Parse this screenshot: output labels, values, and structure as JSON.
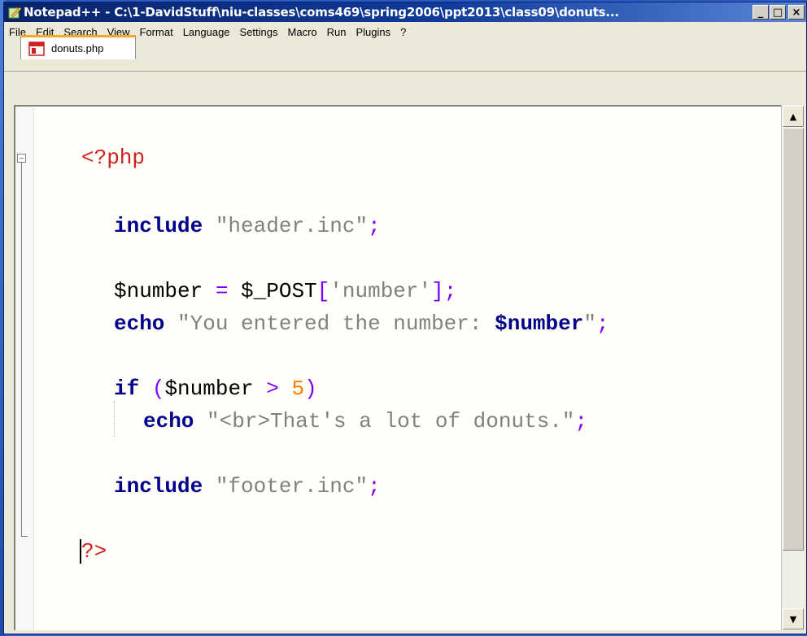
{
  "window": {
    "title": "Notepad++ - C:\\1-DavidStuff\\niu-classes\\coms469\\spring2006\\ppt2013\\class09\\donuts...",
    "minimize_label": "_",
    "maximize_label": "□",
    "close_label": "×"
  },
  "menubar": {
    "items": [
      "File",
      "Edit",
      "Search",
      "View",
      "Format",
      "Language",
      "Settings",
      "Macro",
      "Run",
      "Plugins",
      "?"
    ]
  },
  "tabs": [
    {
      "label": "donuts.php",
      "icon": "php-file-icon",
      "active": true
    }
  ],
  "editor": {
    "lines": [
      {
        "text": "<?php"
      },
      {
        "kw": "include",
        "str": "\"header.inc\"",
        "end": ";"
      },
      {
        "a": "$number",
        "b": "=",
        "c": "$_POST",
        "d": "[",
        "e": "'number'",
        "f": "]",
        "g": ";"
      },
      {
        "kw": "echo",
        "s1": "\"You entered the number: ",
        "v": "$number",
        "s2": "\"",
        "end": ";"
      },
      {
        "kw": "if",
        "rest1": "(",
        "v": "$number",
        "op": ">",
        "num": "5",
        "rest2": ")"
      },
      {
        "kw": "echo",
        "str": "\"<br>That's a lot of donuts.\"",
        "end": ";"
      },
      {
        "kw": "include",
        "str": "\"footer.inc\"",
        "end": ";"
      },
      {
        "text": "?>"
      }
    ]
  },
  "colors": {
    "titlebar": "#0a246a",
    "keyword": "#00008b",
    "string": "#808080",
    "operator": "#8000ff",
    "php_tag": "#d02020",
    "number": "#ff8000"
  },
  "scrollbar": {
    "up_label": "▲",
    "down_label": "▼"
  }
}
